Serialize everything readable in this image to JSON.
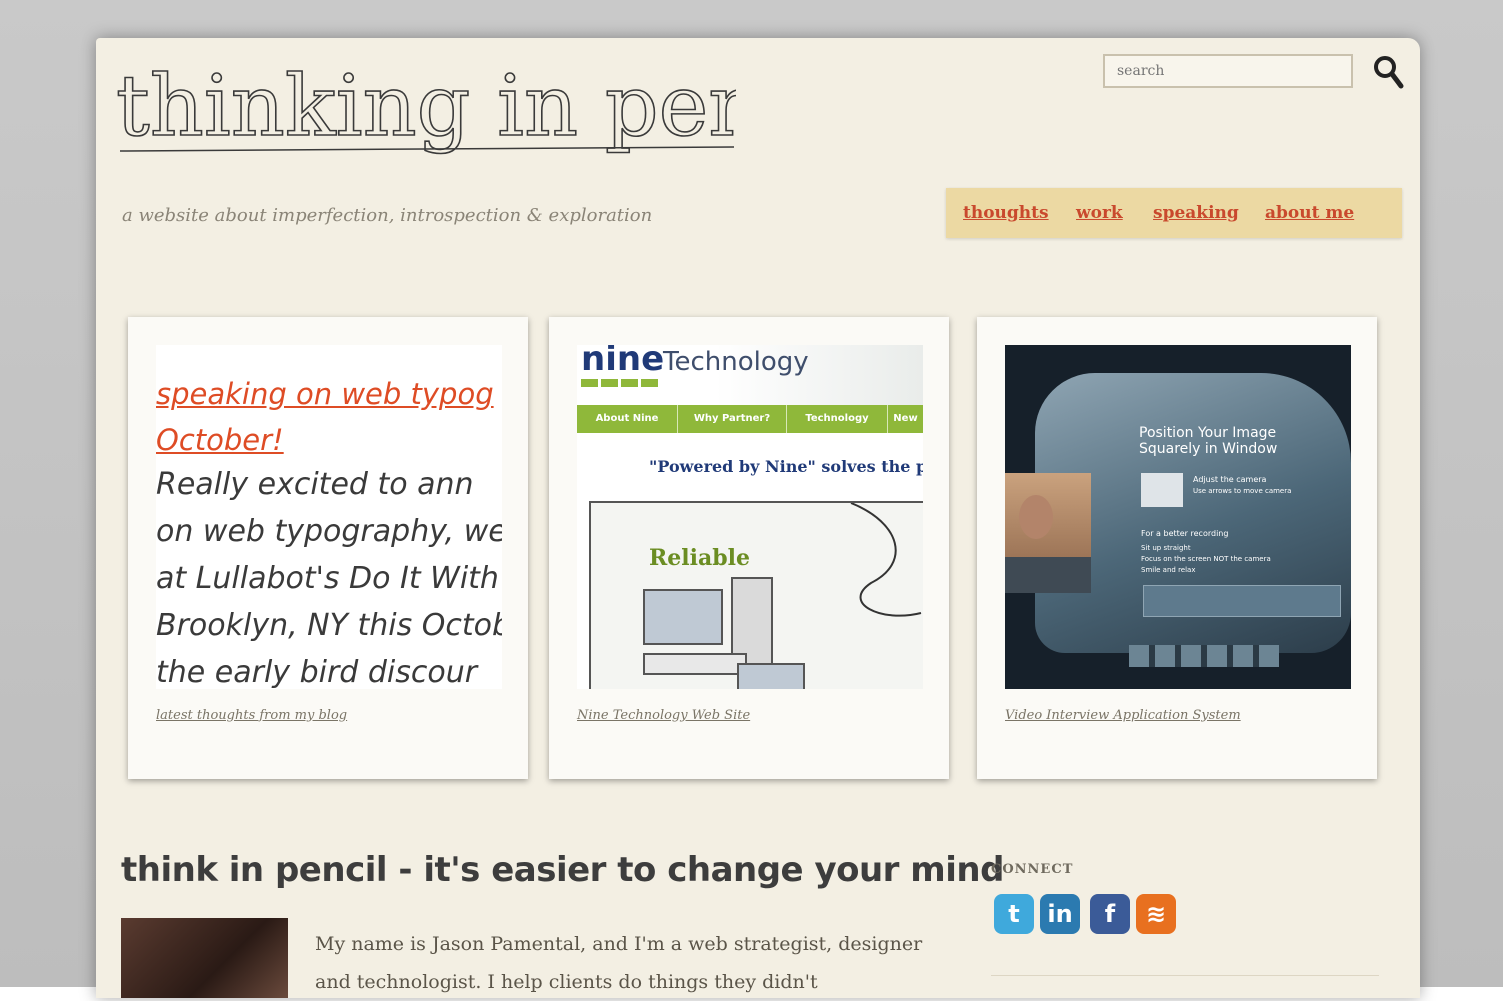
{
  "header": {
    "logo_text": "thinking in pencil",
    "tagline": "a website about imperfection, introspection & exploration",
    "search_placeholder": "search"
  },
  "nav": {
    "items": [
      "thoughts",
      "work",
      "speaking",
      "about me"
    ]
  },
  "cards": [
    {
      "blog_title_lines": [
        "speaking on web typog",
        "October!"
      ],
      "blog_body_lines": [
        "Really excited to ann",
        "on web typography, we'",
        "at Lullabot's Do It With",
        "Brooklyn, NY this Octob",
        "the early bird discour"
      ],
      "caption": "latest thoughts from my blog"
    },
    {
      "brand": "nine",
      "brand_suffix": "Technology",
      "menu": [
        "About Nine",
        "Why Partner?",
        "Technology",
        "New"
      ],
      "tagline": "\"Powered by Nine\" solves the p",
      "callout": "Reliable",
      "caption": "Nine Technology Web Site"
    },
    {
      "panel_title": "Position Your Image Squarely in Window",
      "adjust": "Adjust the camera",
      "adjust_hint": "Use arrows to move camera",
      "tips_title": "For a better recording",
      "tips": [
        "Sit up straight",
        "Focus on the screen NOT the camera",
        "Smile and relax"
      ],
      "caption": "Video Interview Application System"
    }
  ],
  "main": {
    "headline": "think in pencil - it's easier to change your mind",
    "intro": "My name is Jason Pamental, and I'm a web strategist, designer and technologist. I help clients do things they didn't"
  },
  "sidebar": {
    "connect_label": "CONNECT",
    "social": [
      {
        "name": "twitter",
        "glyph": "t"
      },
      {
        "name": "linkedin",
        "glyph": "in"
      },
      {
        "name": "facebook",
        "glyph": "f"
      },
      {
        "name": "rss",
        "glyph": "≋"
      }
    ]
  }
}
